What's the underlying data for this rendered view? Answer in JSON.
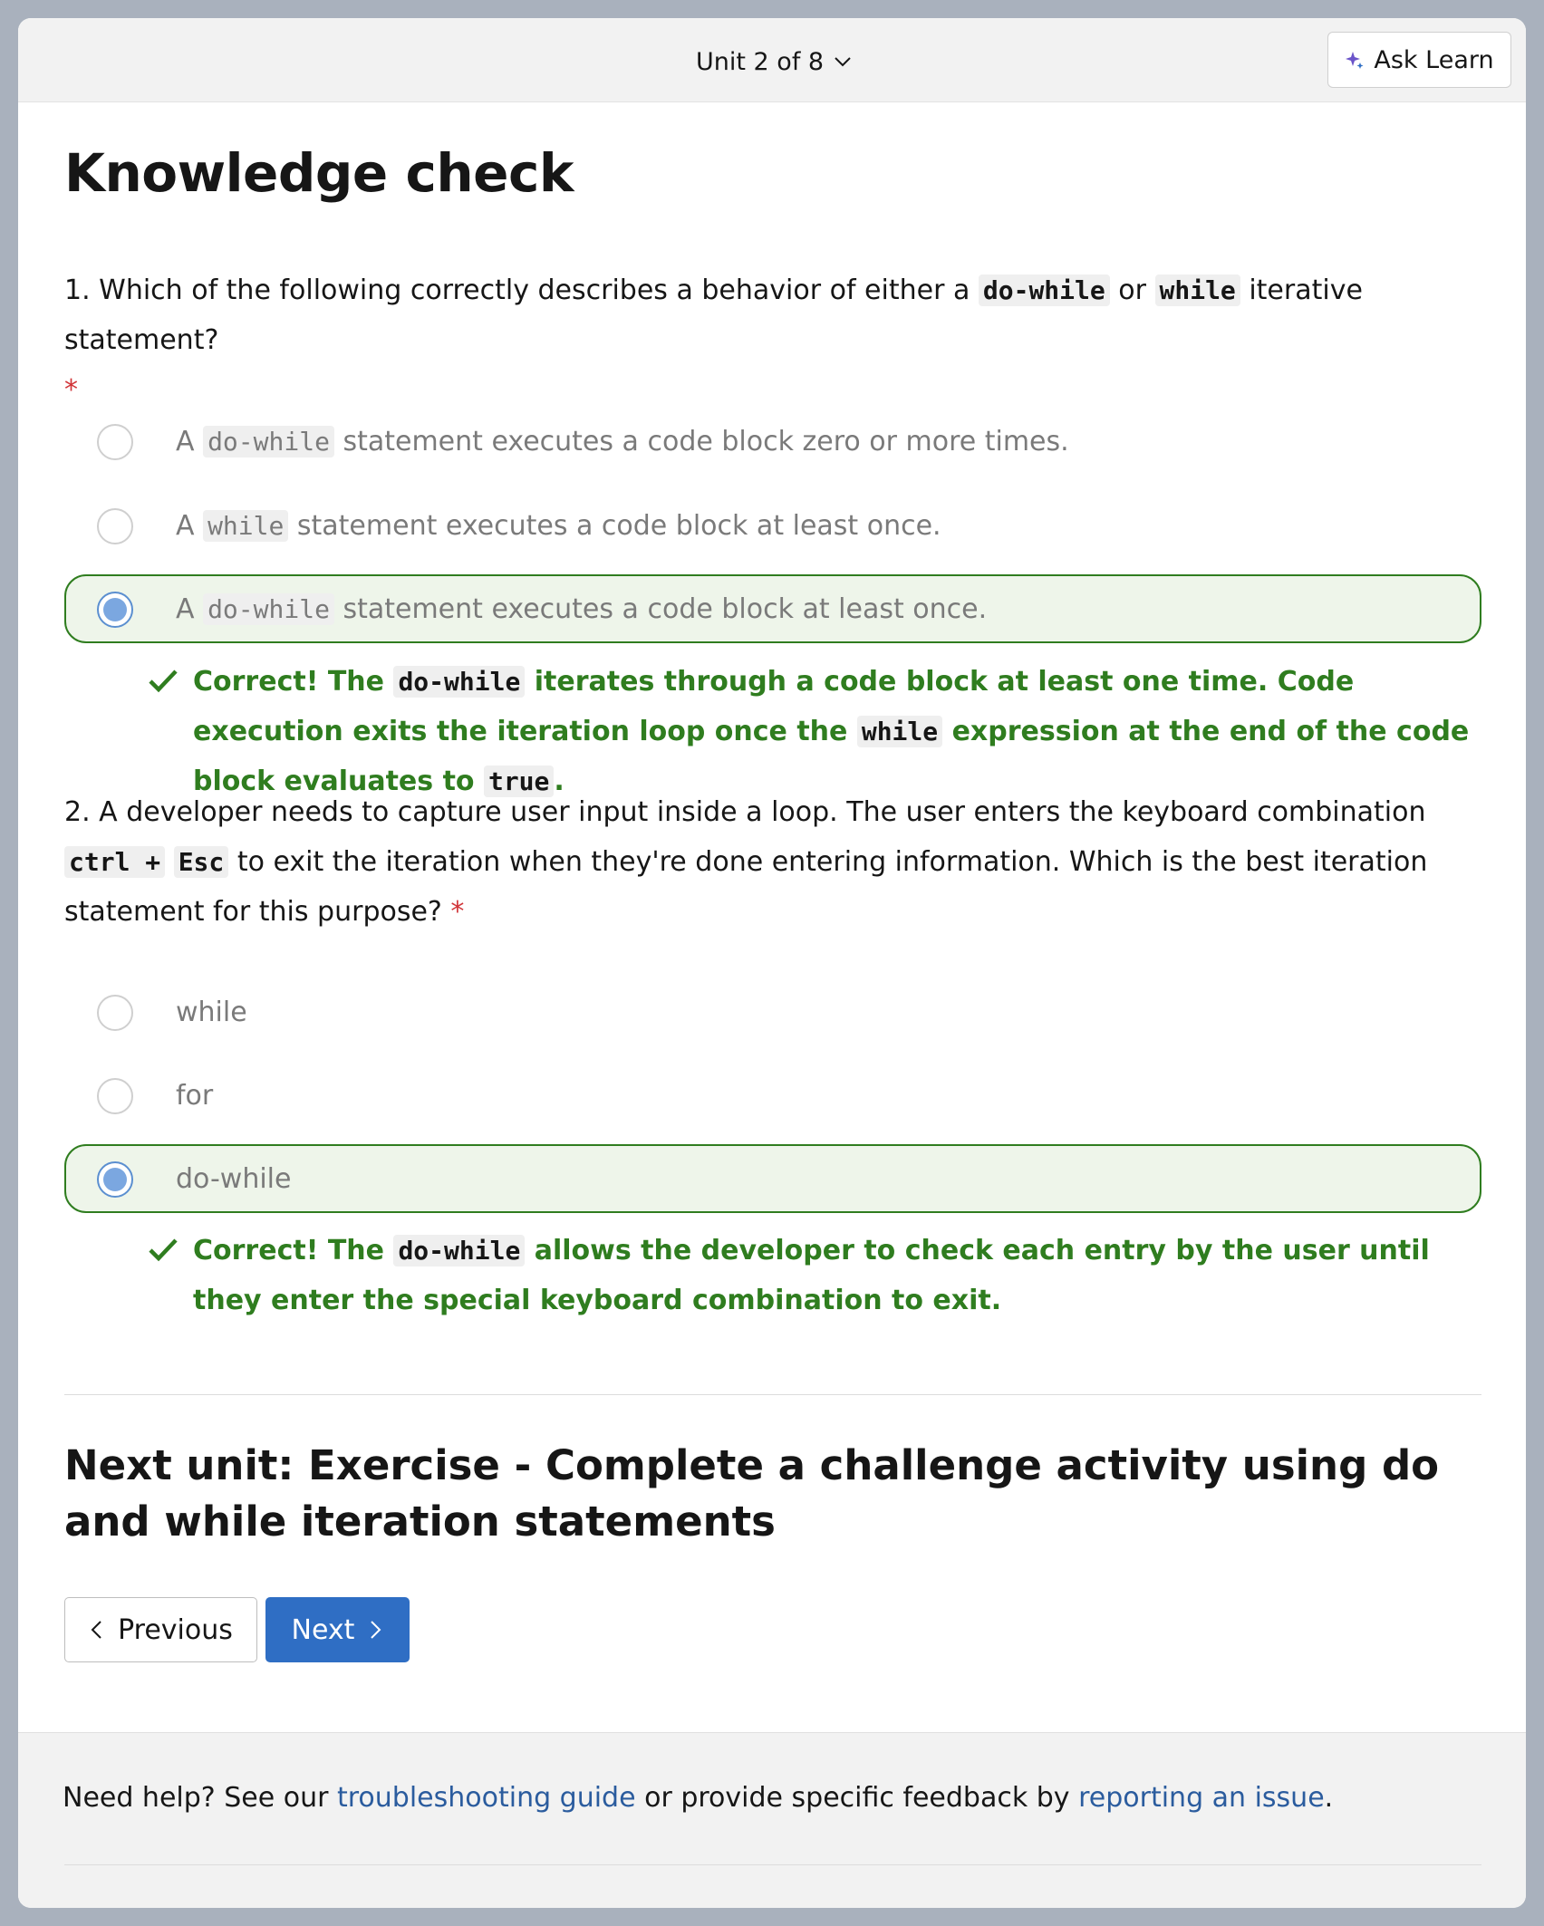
{
  "topbar": {
    "unit_label": "Unit 2 of 8",
    "ask_learn_label": "Ask Learn"
  },
  "page_title": "Knowledge check",
  "colors": {
    "correct_green": "#2f7d1f",
    "selected_bg": "#eef5ea",
    "link_blue": "#2b5c9e",
    "primary_button": "#2f6ec4",
    "required_red": "#d13438"
  },
  "questions": [
    {
      "prompt_prefix": "1. Which of the following correctly describes a behavior of either a ",
      "code1": "do-while",
      "mid": " or ",
      "code2": "while",
      "prompt_suffix": " iterative statement?",
      "required_mark": "*",
      "options": [
        {
          "pre": "A ",
          "code": "do-while",
          "post": " statement executes a code block zero or more times.",
          "selected": false
        },
        {
          "pre": "A ",
          "code": "while",
          "post": " statement executes a code block at least once.",
          "selected": false
        },
        {
          "pre": "A ",
          "code": "do-while",
          "post": " statement executes a code block at least once.",
          "selected": true
        }
      ],
      "feedback": {
        "p1": "Correct! The ",
        "code1": "do-while",
        "p2": " iterates through a code block at least one time. Code execution exits the iteration loop once the ",
        "code2": "while",
        "p3": " expression at the end of the code block evaluates to ",
        "code3": "true",
        "p4": "."
      }
    },
    {
      "prompt_prefix": "2. A developer needs to capture user input inside a loop. The user enters the keyboard combination ",
      "code1": "ctrl +",
      "code1b": "Esc",
      "prompt_suffix": " to exit the iteration when they're done entering information. Which is the best iteration statement for this purpose?",
      "required_mark": "*",
      "options": [
        {
          "label": "while",
          "selected": false
        },
        {
          "label": "for",
          "selected": false
        },
        {
          "label": "do-while",
          "selected": true
        }
      ],
      "feedback": {
        "p1": "Correct! The ",
        "code1": "do-while",
        "p2": " allows the developer to check each entry by the user until they enter the special keyboard combination to exit."
      }
    }
  ],
  "next_unit": {
    "title": "Next unit: Exercise - Complete a challenge activity using do and while iteration statements",
    "previous_label": "Previous",
    "next_label": "Next"
  },
  "footer": {
    "help_prefix": "Need help? See our ",
    "link1": "troubleshooting guide",
    "help_mid": " or provide specific feedback by ",
    "link2": "reporting an issue",
    "help_suffix": "."
  }
}
